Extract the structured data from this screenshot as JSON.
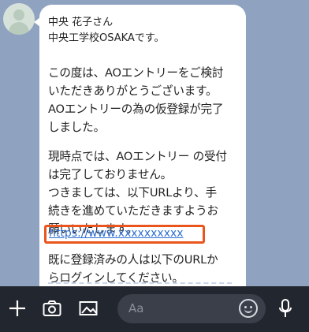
{
  "message": {
    "lines": [
      "中央 花子さん",
      "中央工学校OSAKAです。",
      "",
      "この度は、AOエントリーをご検討",
      "いただきありがとうございます。",
      "AOエントリーの為の仮登録が完了",
      "しました。",
      "",
      "現時点では、AOエントリー の受付",
      "は完了しておりません。",
      "つきましては、以下URLより、手",
      "続きを進めていただきますようお",
      "願いいたします。",
      "https://www.xxxxxxxxxx",
      "既に登録済みの人は以下のURLか",
      "らログインしてください。"
    ]
  },
  "input": {
    "placeholder": "Aa"
  },
  "icons": {
    "plus": "plus-icon",
    "camera": "camera-icon",
    "image": "image-icon",
    "emoji": "emoji-icon",
    "mic": "microphone-icon"
  },
  "colors": {
    "chat_background": "#8fa3c1",
    "bubble": "#ffffff",
    "link": "#2f6fd1",
    "link_highlight": "#e9551d",
    "toolbar": "#22262e"
  }
}
